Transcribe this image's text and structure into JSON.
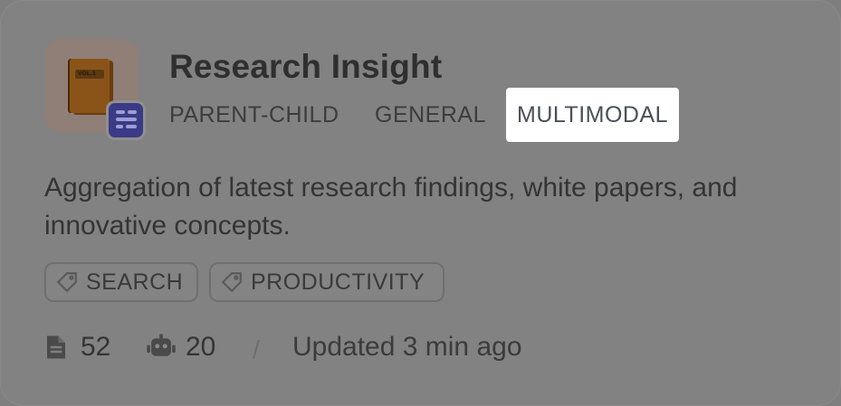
{
  "card": {
    "title": "Research Insight",
    "modes": [
      "PARENT-CHILD",
      "GENERAL",
      "MULTIMODAL"
    ],
    "highlighted_mode": "MULTIMODAL",
    "description": "Aggregation of latest research findings, white papers, and innovative concepts.",
    "tags": [
      "SEARCH",
      "PRODUCTIVITY"
    ],
    "stats": {
      "documents": "52",
      "bots": "20",
      "separator": "/",
      "updated": "Updated 3 min ago"
    },
    "icons": {
      "app": "book-icon",
      "badge": "list-icon",
      "tag": "tag-icon",
      "documents": "document-icon",
      "bots": "robot-icon"
    }
  },
  "colors": {
    "overlay_background": "#828282",
    "highlight_background": "#ffffff",
    "badge": "#3b3a86"
  }
}
